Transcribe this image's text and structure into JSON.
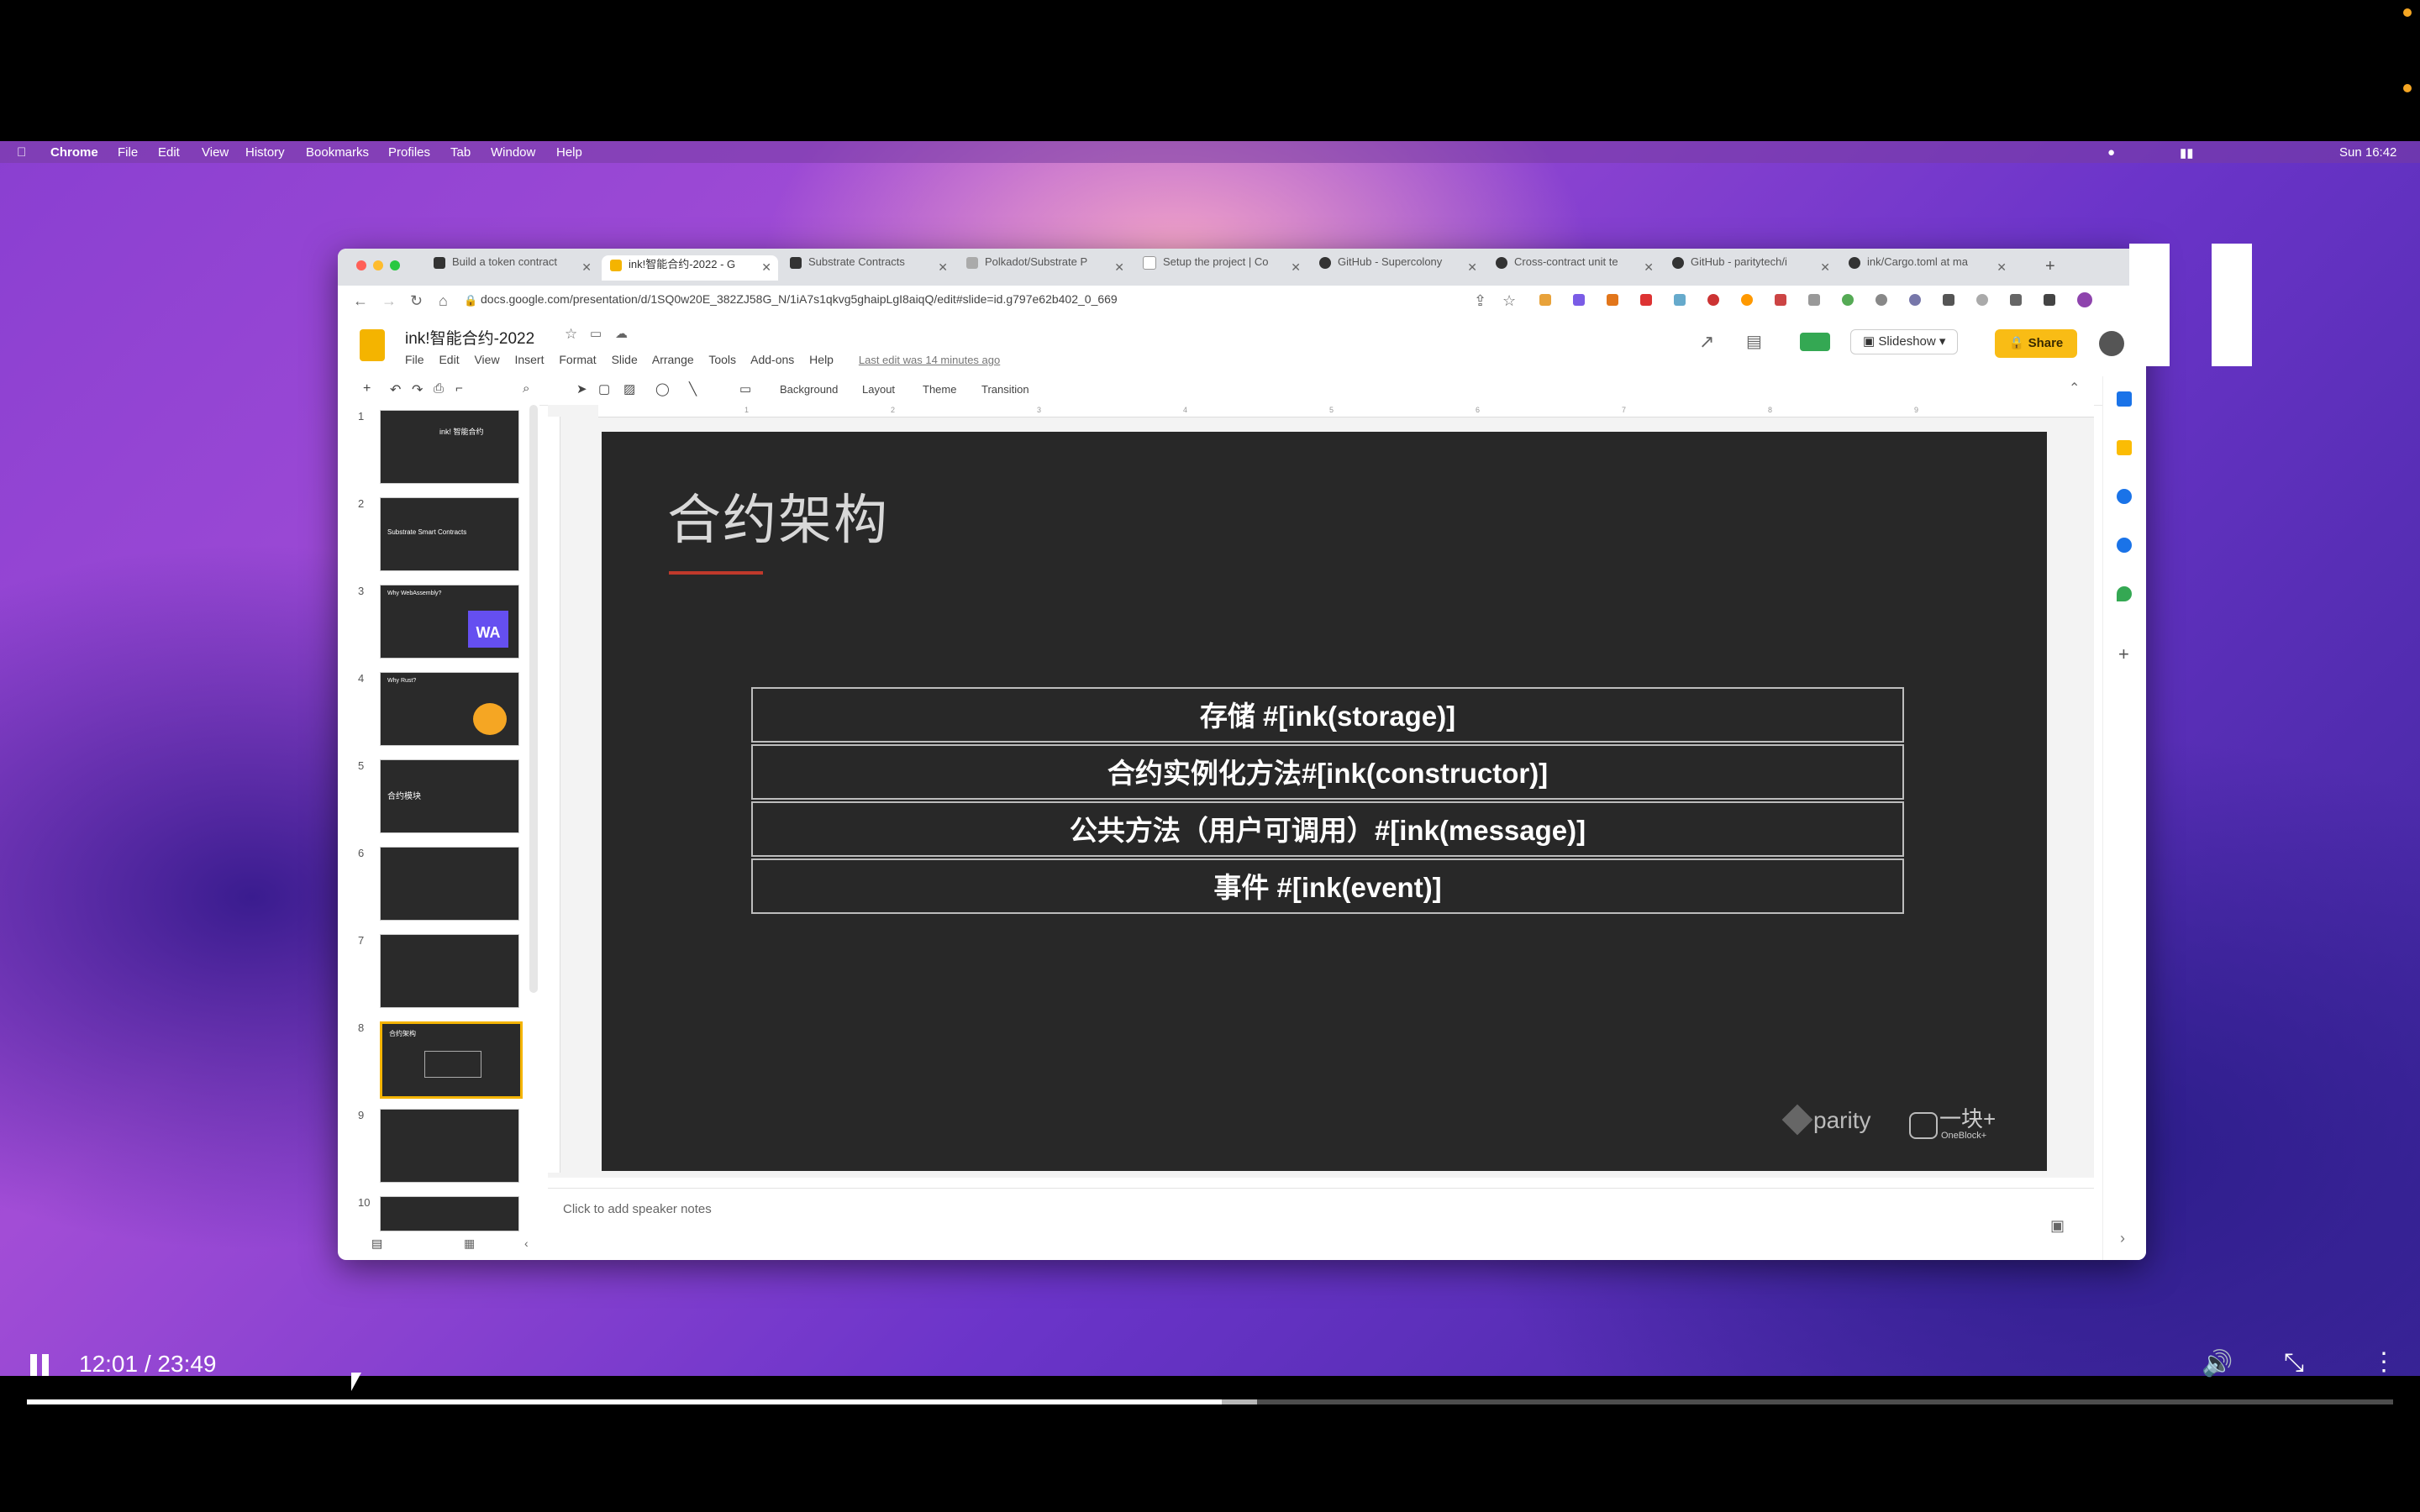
{
  "macos": {
    "app": "Chrome",
    "menus": [
      "File",
      "Edit",
      "View",
      "History",
      "Bookmarks",
      "Profiles",
      "Tab",
      "Window",
      "Help"
    ],
    "clock": "Sun 16:42"
  },
  "browser": {
    "tabs": [
      {
        "label": "Build a token contract",
        "active": false
      },
      {
        "label": "ink!智能合约-2022 - G",
        "active": true
      },
      {
        "label": "Substrate Contracts",
        "active": false
      },
      {
        "label": "Polkadot/Substrate P",
        "active": false
      },
      {
        "label": "Setup the project | Co",
        "active": false
      },
      {
        "label": "GitHub - Supercolony",
        "active": false
      },
      {
        "label": "Cross-contract unit te",
        "active": false
      },
      {
        "label": "GitHub - paritytech/i",
        "active": false
      },
      {
        "label": "ink/Cargo.toml at ma",
        "active": false
      }
    ],
    "new_tab": "+",
    "url": "docs.google.com/presentation/d/1SQ0w20E_382ZJ58G_N/1iA7s1qkvg5ghaipLgI8aiqQ/edit#slide=id.g797e62b402_0_669"
  },
  "slides_app": {
    "doc_title": "ink!智能合约-2022",
    "menu": [
      "File",
      "Edit",
      "View",
      "Insert",
      "Format",
      "Slide",
      "Arrange",
      "Tools",
      "Add-ons",
      "Help"
    ],
    "last_edit": "Last edit was 14 minutes ago",
    "slideshow_label": "Slideshow",
    "share_label": "Share",
    "toolbar": {
      "background": "Background",
      "layout": "Layout",
      "theme": "Theme",
      "transition": "Transition"
    },
    "ruler_marks": [
      "1",
      "2",
      "3",
      "4",
      "5",
      "6",
      "7",
      "8",
      "9"
    ],
    "thumbnails": [
      {
        "num": "1",
        "text": "ink! 智能合约"
      },
      {
        "num": "2",
        "text": "Substrate Smart Contracts"
      },
      {
        "num": "3",
        "text": "Why WebAssembly?",
        "badge": "WA"
      },
      {
        "num": "4",
        "text": "Why Rust?"
      },
      {
        "num": "5",
        "text": "合约模块"
      },
      {
        "num": "6",
        "text": ""
      },
      {
        "num": "7",
        "text": ""
      },
      {
        "num": "8",
        "text": "合约架构"
      },
      {
        "num": "9",
        "text": ""
      },
      {
        "num": "10",
        "text": ""
      }
    ],
    "selected_slide": 8,
    "speaker_notes_placeholder": "Click to add speaker notes"
  },
  "slide": {
    "title": "合约架构",
    "rows": [
      "存储 #[ink(storage)]",
      "合约实例化方法#[ink(constructor)]",
      "公共方法（用户可调用）#[ink(message)]",
      "事件 #[ink(event)]"
    ],
    "logo_parity": "parity",
    "logo_oneblock": "一块+",
    "logo_oneblock_sub": "OneBlock+"
  },
  "player": {
    "current_time": "12:01",
    "separator": " / ",
    "duration": "23:49",
    "progress_fraction": 0.505,
    "buffered_fraction": 0.52
  },
  "colors": {
    "slide_bg": "#282828",
    "accent_underline": "#c0392b",
    "share_button": "#f9bc15"
  }
}
